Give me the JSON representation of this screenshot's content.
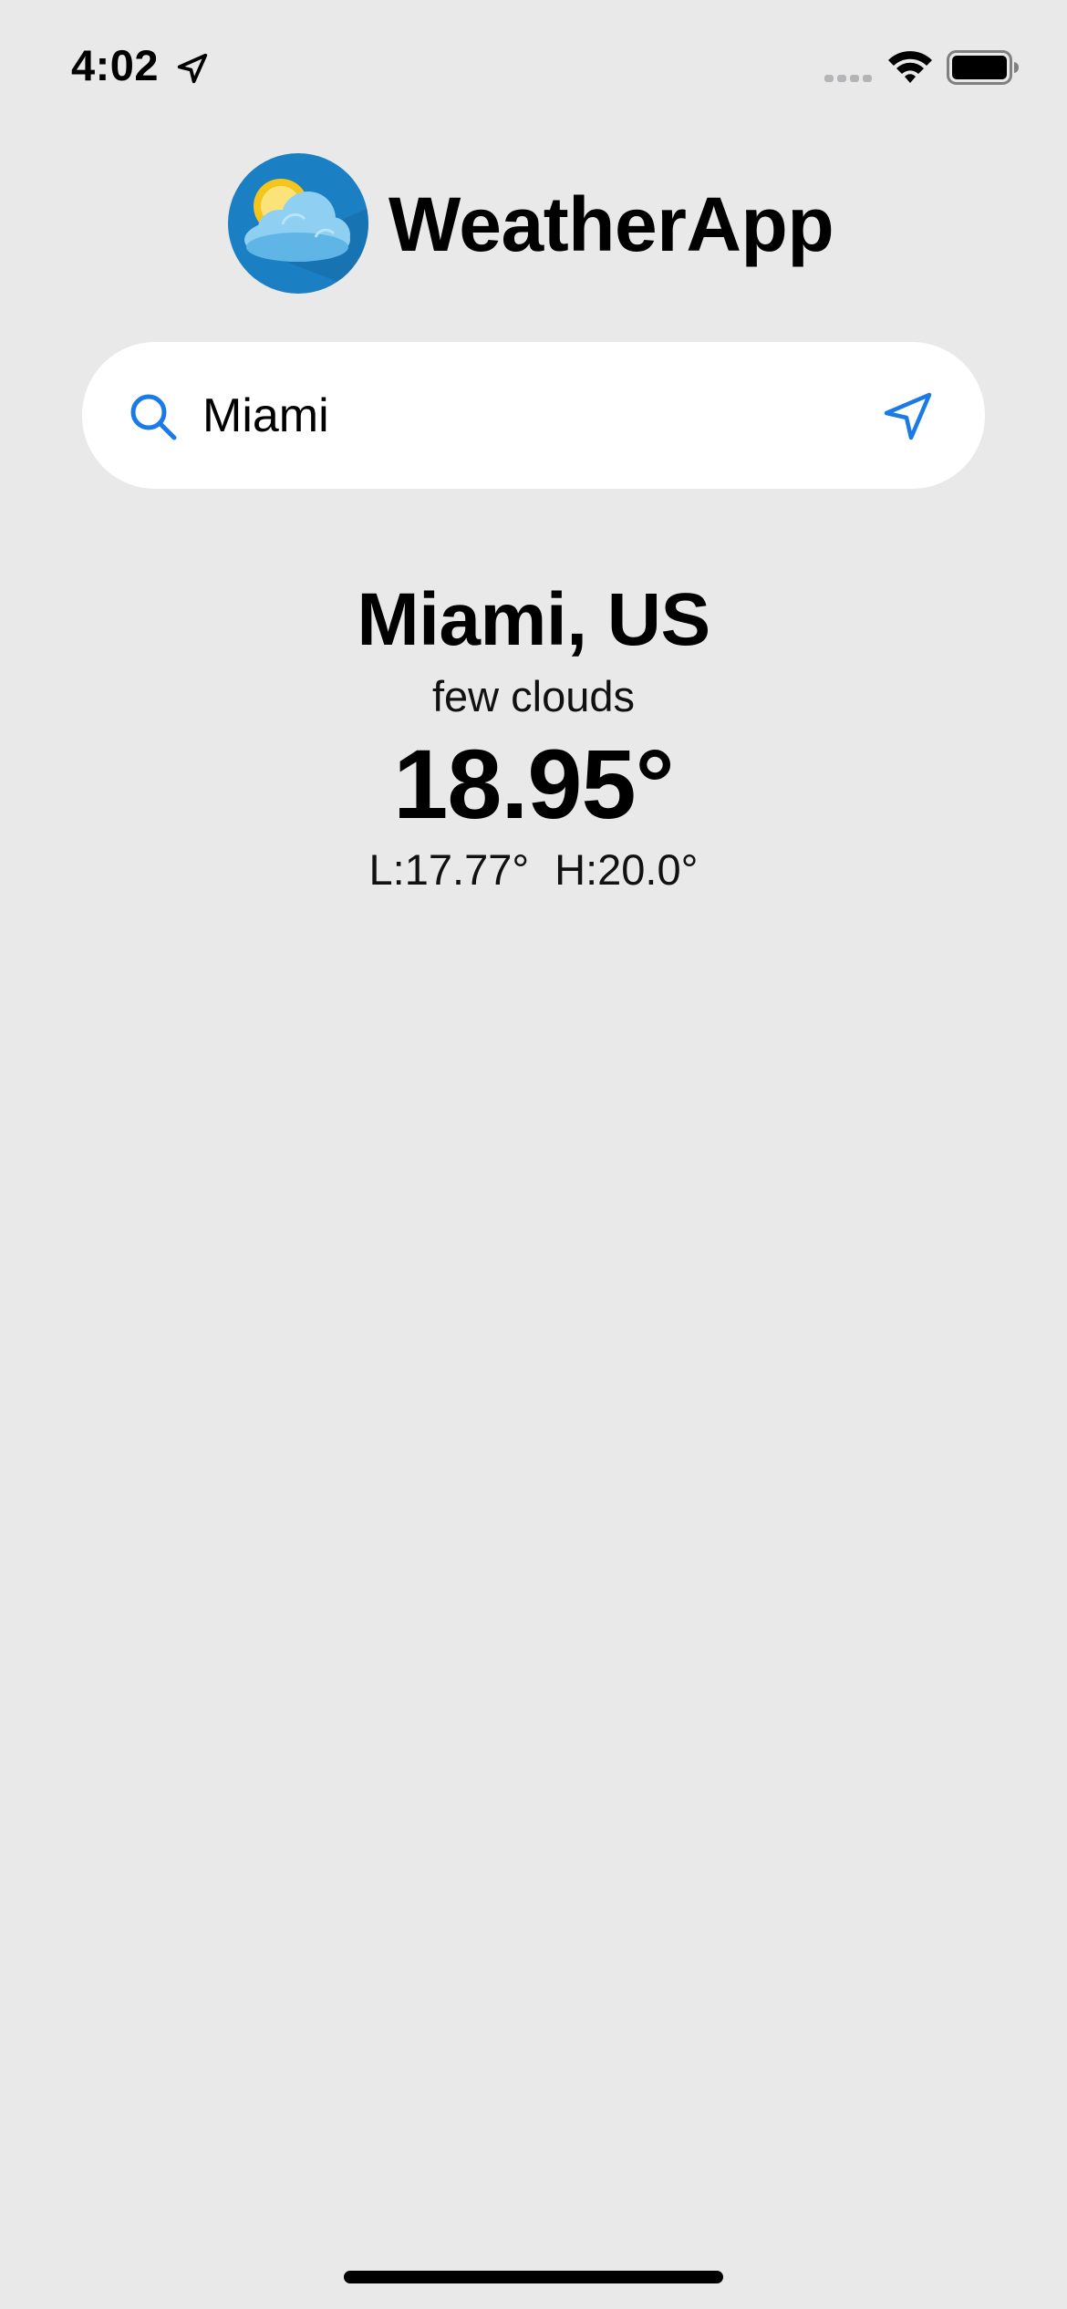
{
  "status_bar": {
    "time": "4:02",
    "icons": [
      "location-arrow-icon",
      "cellular-signal-icon",
      "wifi-icon",
      "battery-icon"
    ]
  },
  "header": {
    "title": "WeatherApp",
    "logo_icon": "sun-cloud-icon"
  },
  "search": {
    "value": "Miami",
    "placeholder": "",
    "search_icon": "search-icon",
    "location_icon": "location-arrow-icon"
  },
  "weather": {
    "city": "Miami, US",
    "description": "few clouds",
    "temperature": "18.95°",
    "low": "L:17.77°",
    "high": "H:20.0°"
  },
  "colors": {
    "background": "#e9e9ea",
    "accent": "#1a7ae6",
    "search_bg": "#ffffff",
    "logo_bg": "#1b7fc3"
  }
}
